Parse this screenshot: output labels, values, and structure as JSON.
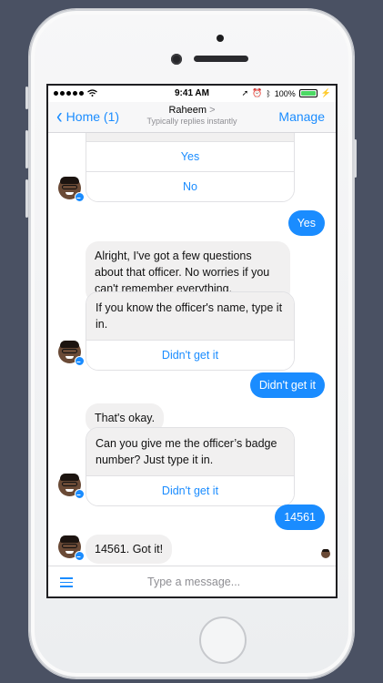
{
  "statusbar": {
    "signal": "•••••",
    "wifi_icon": "wifi-icon",
    "time": "9:41 AM",
    "battery": "100%",
    "battery_level": 1.0
  },
  "navbar": {
    "back_label": "Home (1)",
    "title": "Raheem",
    "title_arrow": ">",
    "subtitle": "Typically replies instantly",
    "action_label": "Manage"
  },
  "messages": {
    "card1": {
      "partial_text": "...",
      "buttons": [
        "Yes",
        "No"
      ]
    },
    "out1": "Yes",
    "in1": "Alright, I've got a few questions about that officer. No worries if you can't remember everything.",
    "card2": {
      "text": "If you know the officer's name, type it in.",
      "button": "Didn't get it"
    },
    "out2": "Didn't get it",
    "in2": "That's okay.",
    "card3": {
      "text": "Can you give me the officer’s badge number? Just type it in.",
      "button": "Didn't get it"
    },
    "out3": "14561",
    "in3": "14561. Got it!"
  },
  "input": {
    "placeholder": "Type a message..."
  },
  "colors": {
    "accent": "#1a8cff",
    "incoming_bubble": "#f1f0f0",
    "background": "#4a5163"
  }
}
